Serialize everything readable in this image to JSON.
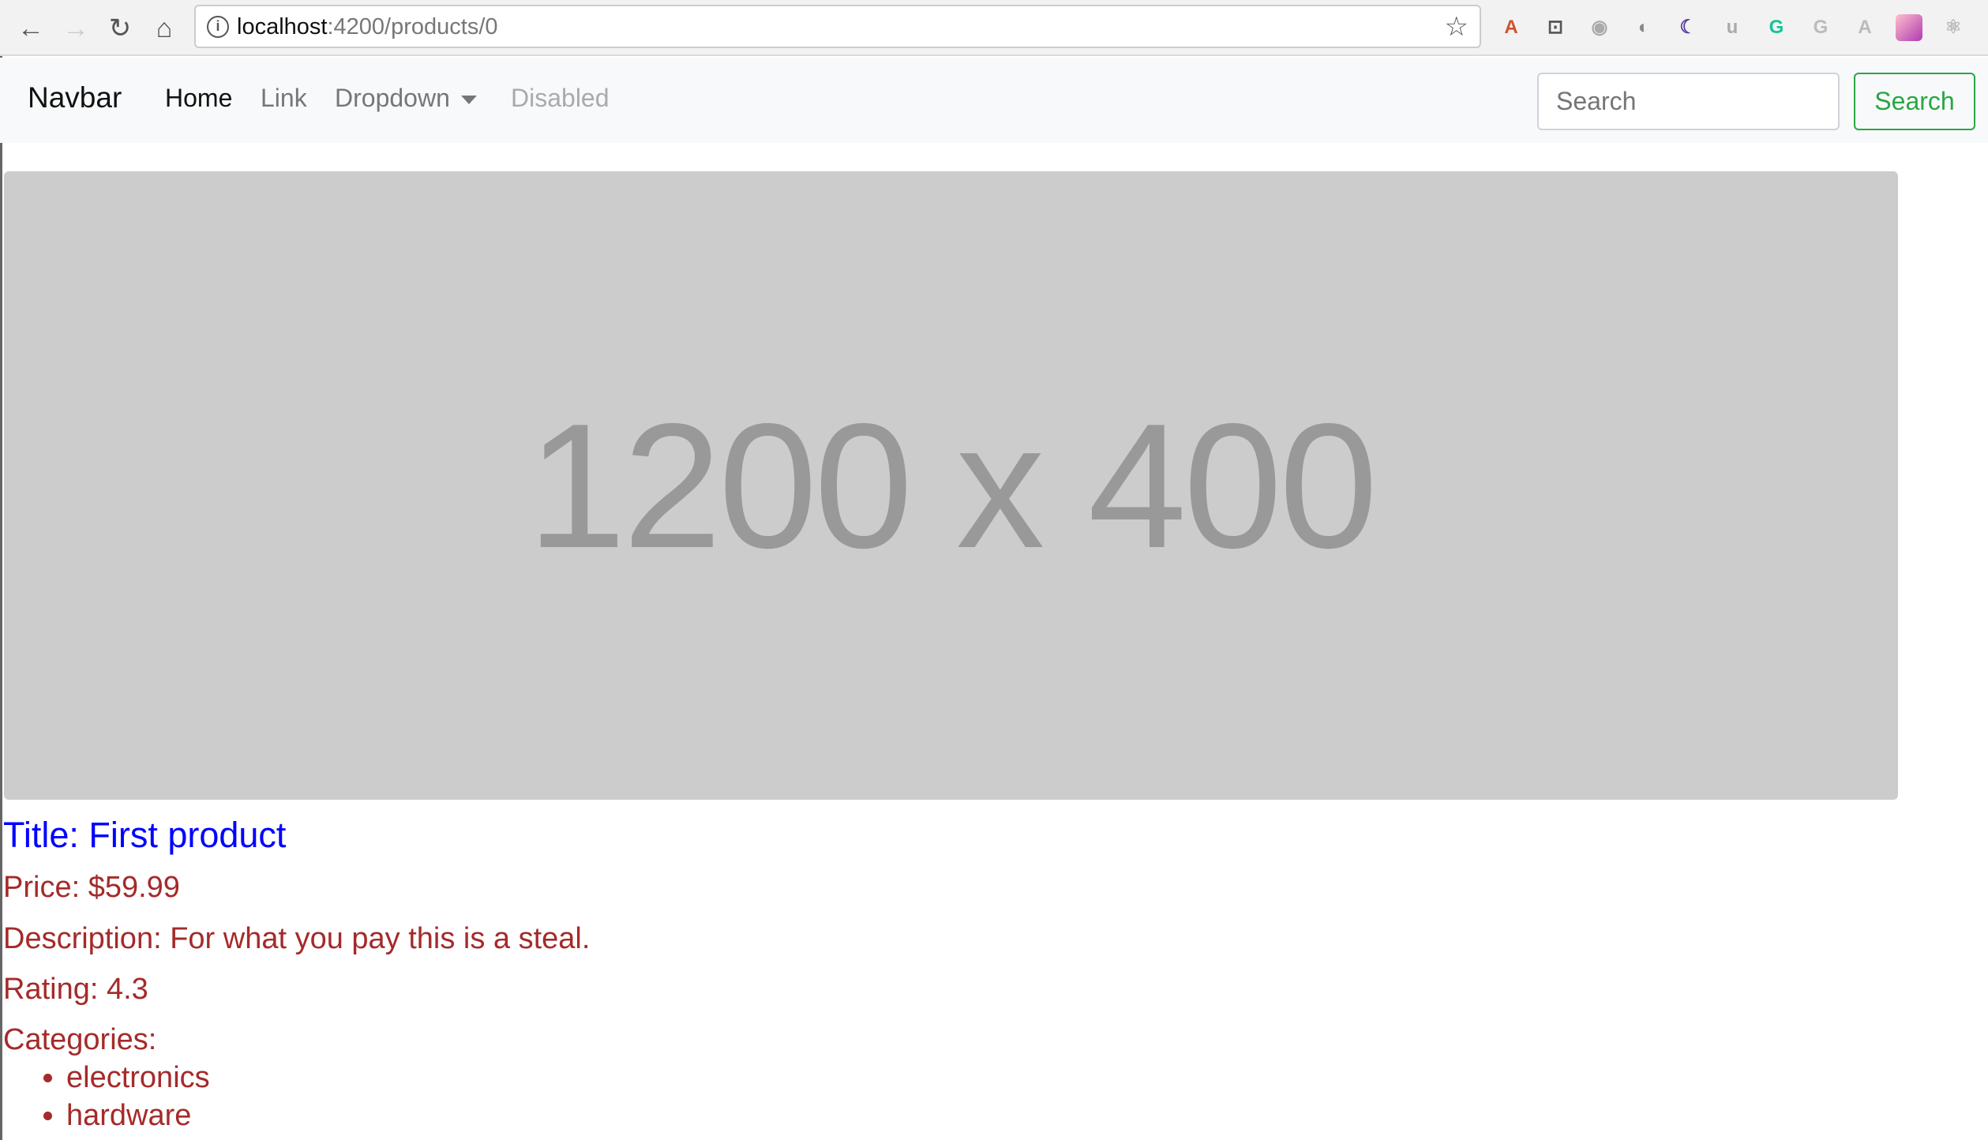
{
  "browser": {
    "url_host": "localhost",
    "url_rest": ":4200/products/0",
    "extensions": [
      {
        "name": "font-a-icon",
        "glyph": "A",
        "color": "#d2502e"
      },
      {
        "name": "outlet-icon",
        "glyph": "⊡",
        "color": "#555"
      },
      {
        "name": "eye-icon",
        "glyph": "◉",
        "color": "#aaa"
      },
      {
        "name": "shield-icon",
        "glyph": "◐",
        "color": "#888"
      },
      {
        "name": "moon-icon",
        "glyph": "☾",
        "color": "#5b3fa0"
      },
      {
        "name": "u-icon",
        "glyph": "u",
        "color": "#aaa"
      },
      {
        "name": "grammarly-icon",
        "glyph": "G",
        "color": "#15c39a"
      },
      {
        "name": "g-icon",
        "glyph": "G",
        "color": "#bbb"
      },
      {
        "name": "angular-icon",
        "glyph": "A",
        "color": "#bbb"
      },
      {
        "name": "palette-icon",
        "glyph": "",
        "color": "#e07ab8"
      },
      {
        "name": "react-icon",
        "glyph": "⚛",
        "color": "#bbb"
      }
    ]
  },
  "navbar": {
    "brand": "Navbar",
    "links": [
      "Home",
      "Link",
      "Dropdown",
      "Disabled"
    ],
    "search_placeholder": "Search",
    "search_button": "Search"
  },
  "hero": {
    "label": "1200 x 400"
  },
  "product": {
    "title": "Title: First product",
    "price": "Price: $59.99",
    "description": "Description: For what you pay this is a steal.",
    "rating": "Rating: 4.3",
    "categories_label": "Categories:",
    "categories": [
      "electronics",
      "hardware"
    ]
  },
  "colors": {
    "title": "#0000ff",
    "details": "#a52a2a",
    "accent": "#28a745"
  }
}
